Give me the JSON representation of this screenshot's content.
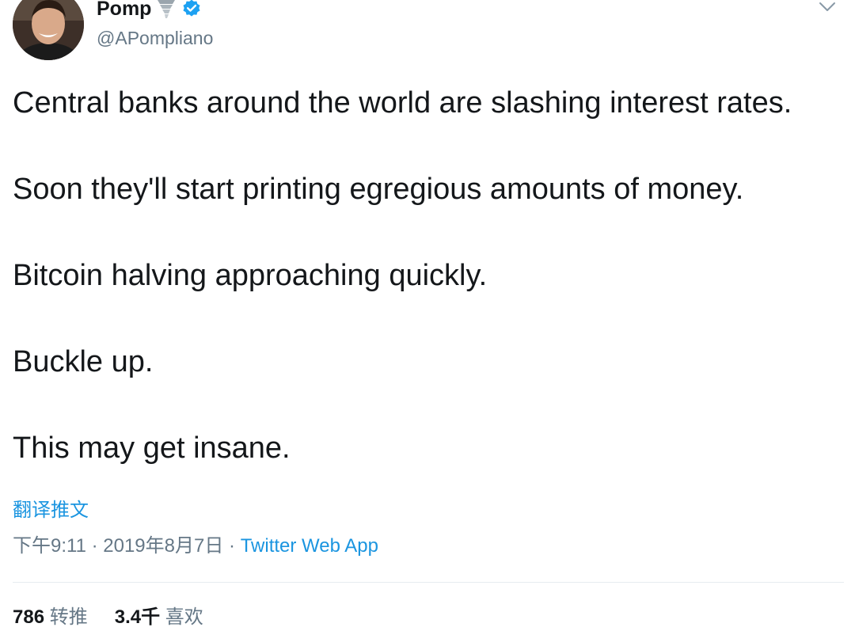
{
  "author": {
    "display_name": "Pomp",
    "handle": "@APompliano",
    "avatar_icon": "profile-photo",
    "badge_icons": [
      "tornado-emoji",
      "verified-badge-icon"
    ],
    "verified_color": "#1da1f2"
  },
  "tweet": {
    "lines": [
      "Central banks around the world are slashing interest rates.",
      "Soon they'll start printing egregious amounts of money.",
      "Bitcoin halving approaching quickly.",
      "Buckle up.",
      "This may get insane."
    ],
    "translate_label": "翻译推文"
  },
  "meta": {
    "time": "下午9:11",
    "separator1": " · ",
    "date": "2019年8月7日",
    "separator2": " · ",
    "source": "Twitter Web App"
  },
  "stats": {
    "retweets_count": "786",
    "retweets_label": "转推",
    "likes_count": "3.4千",
    "likes_label": "喜欢"
  },
  "colors": {
    "link": "#1b95e0",
    "muted": "#657786",
    "text": "#14171a"
  }
}
